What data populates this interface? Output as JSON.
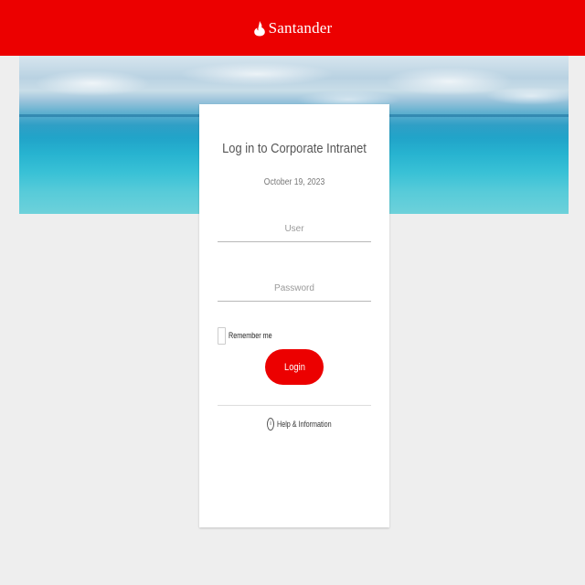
{
  "header": {
    "brand_name": "Santander",
    "brand_color": "#ec0000",
    "logo_icon": "flame-icon"
  },
  "hero": {
    "image": "tropical-sea-and-sky"
  },
  "login_card": {
    "title": "Log in to Corporate Intranet",
    "date": "October 19, 2023",
    "user_placeholder": "User",
    "user_value": "",
    "password_placeholder": "Password",
    "password_value": "",
    "remember_label": "Remember me",
    "remember_checked": false,
    "login_label": "Login",
    "help_label": "Help & Information",
    "help_icon": "info-circle-icon"
  }
}
